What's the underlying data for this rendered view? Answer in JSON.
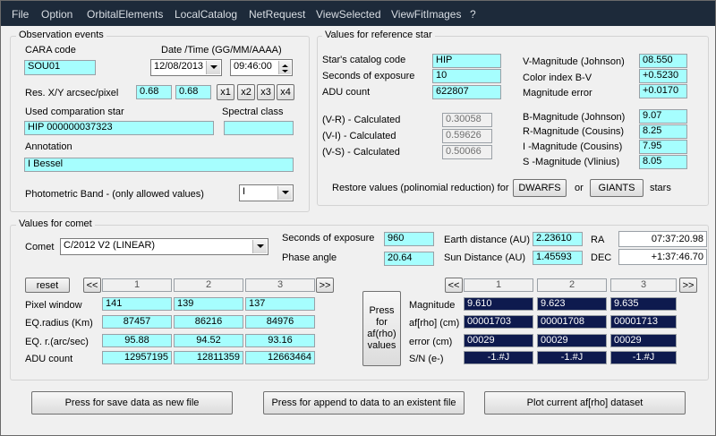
{
  "menu": [
    "File",
    "Option",
    "OrbitalElements",
    "LocalCatalog",
    "NetRequest",
    "ViewSelected",
    "ViewFitImages",
    "?"
  ],
  "obs": {
    "title": "Observation events",
    "cara_label": "CARA code",
    "cara_value": "SOU01",
    "datetime_label": "Date /Time  (GG/MM/AAAA)",
    "date_value": "12/08/2013",
    "time_value": "09:46:00",
    "res_label": "Res. X/Y arcsec/pixel",
    "res_x": "0.68",
    "res_y": "0.68",
    "scale_buttons": [
      "x1",
      "x2",
      "x3",
      "x4"
    ],
    "comp_label": "Used comparation star",
    "comp_value": "HIP 000000037323",
    "spectral_label": "Spectral class",
    "spectral_value": "",
    "annotation_label": "Annotation",
    "annotation_value": "I Bessel",
    "band_label": "Photometric Band  - (only allowed values)",
    "band_value": "I"
  },
  "ref": {
    "title": "Values for reference star",
    "labels": [
      "Star's catalog code",
      "Seconds of exposure",
      "ADU count"
    ],
    "values": [
      "HIP",
      "10",
      "622807"
    ],
    "calc_labels": [
      "(V-R) - Calculated",
      "(V-I) -  Calculated",
      "(V-S) - Calculated"
    ],
    "calc_values": [
      "0.30058",
      "0.59626",
      "0.50066"
    ],
    "mag_labels": [
      "V-Magnitude (Johnson)",
      "Color index B-V",
      "Magnitude error"
    ],
    "mag_values": [
      "08.550",
      "+0.5230",
      "+0.0170"
    ],
    "band_labels": [
      "B-Magnitude (Johnson)",
      "R-Magnitude (Cousins)",
      "I -Magnitude (Cousins)",
      "S -Magnitude (Vlinius)"
    ],
    "band_values": [
      "9.07",
      "8.25",
      "7.95",
      "8.05"
    ],
    "restore_label": "Restore values (polinomial reduction) for",
    "dwarfs": "DWARFS",
    "or_label": "or",
    "giants": "GIANTS",
    "stars_label": "stars"
  },
  "comet": {
    "title": "Values for comet",
    "comet_label": "Comet",
    "comet_value": "C/2012 V2 (LINEAR)",
    "exposure_label": "Seconds of exposure",
    "exposure_value": "960",
    "phase_label": "Phase angle",
    "phase_value": "20.64",
    "earth_label": "Earth distance (AU)",
    "earth_value": "2.23610",
    "sun_label": "Sun Distance (AU)",
    "sun_value": "1.45593",
    "ra_label": "RA",
    "ra_value": "07:37:20.98",
    "dec_label": "DEC",
    "dec_value": "+1:37:46.70",
    "reset": "reset",
    "prev": "<<",
    "next": ">>",
    "cols": [
      "1",
      "2",
      "3"
    ],
    "left_labels": [
      "Pixel window",
      "EQ.radius (Km)",
      "EQ. r.(arc/sec)",
      "ADU count"
    ],
    "left_rows": [
      [
        "141",
        "139",
        "137"
      ],
      [
        "87457",
        "86216",
        "84976"
      ],
      [
        "95.88",
        "94.52",
        "93.16"
      ],
      [
        "12957195",
        "12811359",
        "12663464"
      ]
    ],
    "press_label": "Press for af(rho) values",
    "right_labels": [
      "Magnitude",
      "af[rho] (cm)",
      "error (cm)",
      "S/N (e-)"
    ],
    "right_rows": [
      [
        "9.610",
        "9.623",
        "9.635"
      ],
      [
        "00001703",
        "00001708",
        "00001713"
      ],
      [
        "00029",
        "00029",
        "00029"
      ],
      [
        "-1.#J",
        "-1.#J",
        "-1.#J"
      ]
    ]
  },
  "bottom": {
    "save_new": "Press for save data as new file",
    "append": "Press for append to  data to an existent file",
    "plot": "Plot current af[rho] dataset"
  }
}
